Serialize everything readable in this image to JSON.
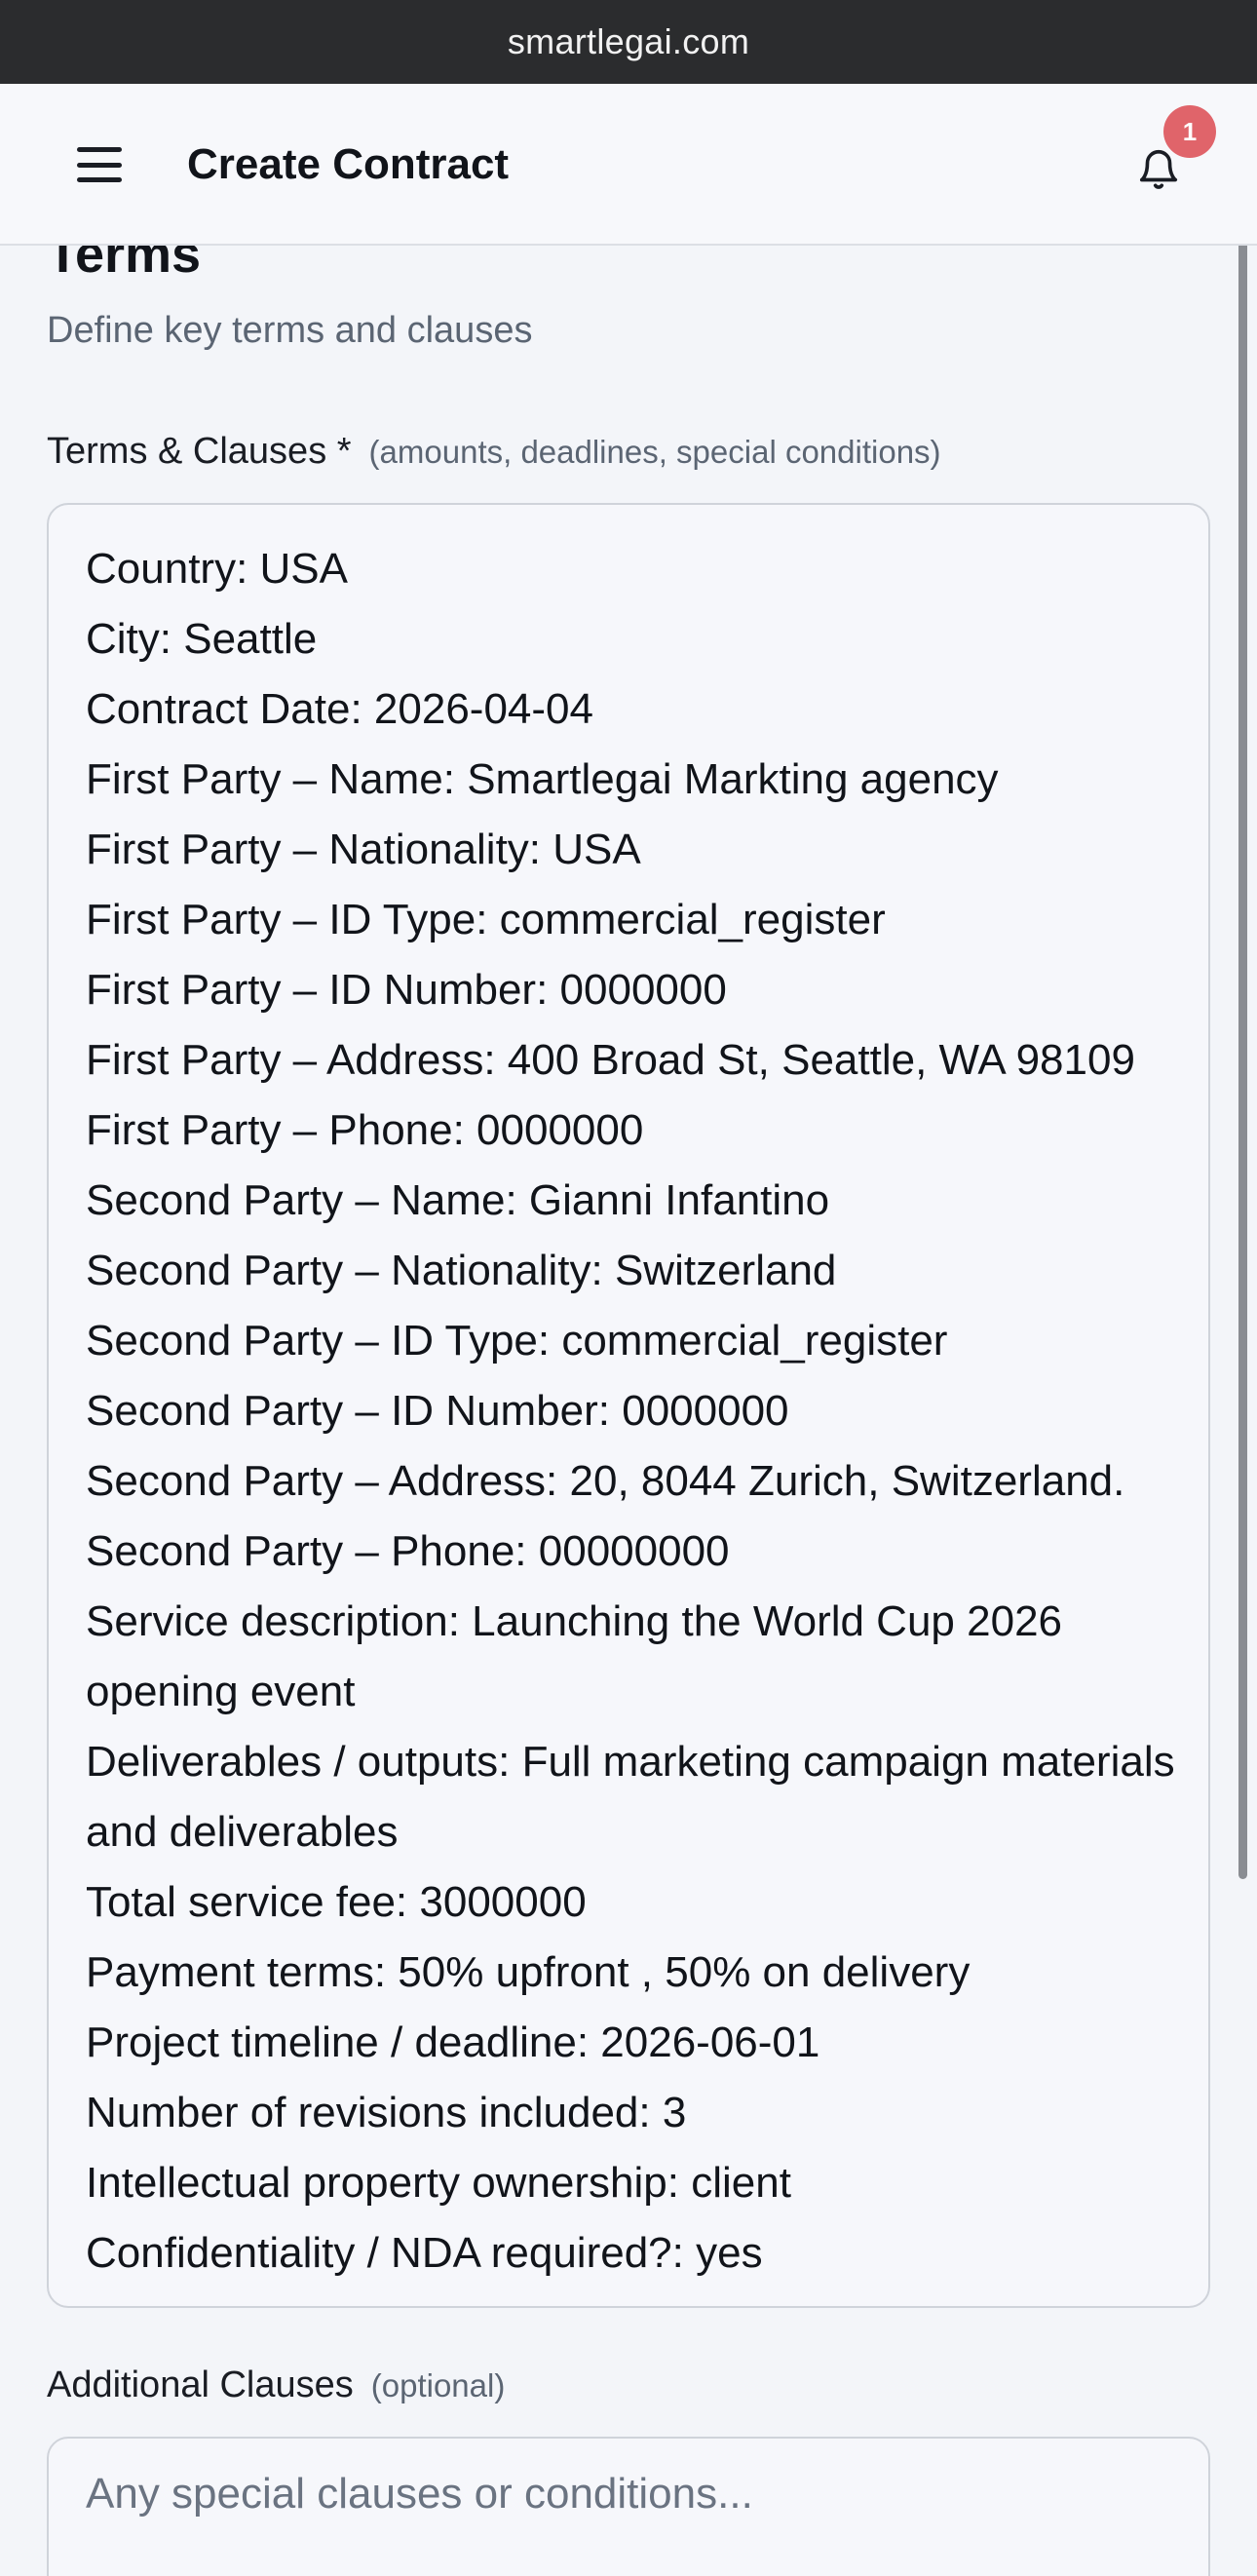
{
  "browser": {
    "url": "smartlegai.com"
  },
  "header": {
    "title": "Create Contract",
    "notification_count": "1"
  },
  "section": {
    "title": "Terms",
    "subtitle": "Define key terms and clauses"
  },
  "terms_field": {
    "label": "Terms & Clauses *",
    "hint": "(amounts, deadlines, special conditions)",
    "lines": [
      "Country: USA",
      "City: Seattle",
      "Contract Date: 2026-04-04",
      "First Party – Name: Smartlegai Markting agency",
      "First Party – Nationality: USA",
      "First Party – ID Type: commercial_register",
      "First Party – ID Number: 0000000",
      "First Party – Address: 400 Broad St, Seattle, WA 98109",
      "First Party – Phone: 0000000",
      "Second Party – Name: Gianni Infantino",
      "Second Party – Nationality: Switzerland",
      "Second Party – ID Type: commercial_register",
      "Second Party – ID Number: 0000000",
      "Second Party – Address: 20, 8044 Zurich, Switzerland.",
      "Second Party – Phone: 00000000",
      "Service description: Launching the World Cup 2026 opening event",
      "Deliverables / outputs: Full marketing campaign materials and deliverables",
      "Total service fee: 3000000",
      "Payment terms: 50% upfront , 50% on delivery",
      "Project timeline / deadline: 2026-06-01",
      "Number of revisions included: 3",
      "Intellectual property ownership: client",
      "Confidentiality / NDA required?: yes"
    ]
  },
  "additional_field": {
    "label": "Additional Clauses",
    "hint": "(optional)",
    "placeholder": "Any special clauses or conditions..."
  },
  "icons": {
    "menu": "hamburger-menu-icon",
    "notifications": "bell-icon"
  },
  "colors": {
    "badge": "#e0646a",
    "urlbar": "#2b2c2e"
  }
}
